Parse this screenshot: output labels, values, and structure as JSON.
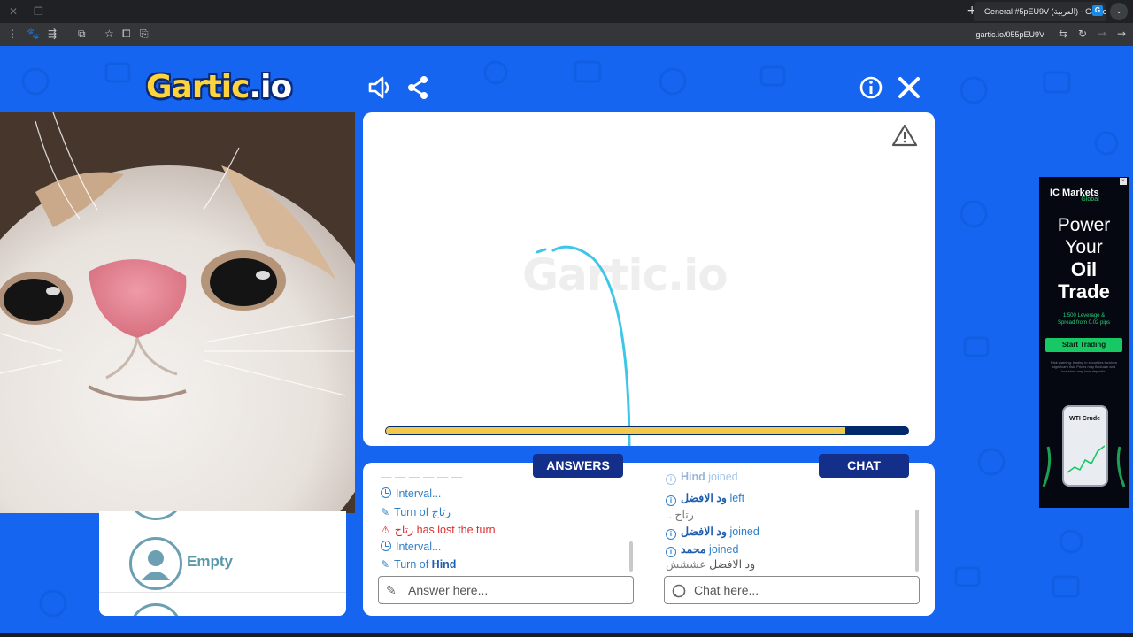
{
  "browser": {
    "tab_title": "General #5pEU9V (العربية) - Gartic",
    "favicon_letter": "G",
    "url": "gartic.io/055pEU9V"
  },
  "game": {
    "logo_main": "Gartic",
    "logo_suffix": ".io",
    "watermark": "Gartic.io",
    "timer_progress": 0.88,
    "drawing_color": "#3ec6e8",
    "progress_fill_color": "#f2c94c"
  },
  "players": {
    "visible_slot_label": "Empty"
  },
  "answers": {
    "tab_label": "ANSWERS",
    "input_placeholder": "Answer here...",
    "lines": [
      {
        "icon": "clock",
        "text": "Interval..."
      },
      {
        "icon": "pencil",
        "prefix": "Turn of ",
        "name": "رتاج"
      },
      {
        "icon": "warning",
        "name": "رتاج",
        "suffix": " has lost the turn"
      },
      {
        "icon": "clock",
        "text": "Interval..."
      },
      {
        "icon": "pencil",
        "prefix": "Turn of ",
        "name": "Hind"
      }
    ]
  },
  "chat": {
    "tab_label": "CHAT",
    "input_placeholder": "Chat here...",
    "lines": [
      {
        "icon": "info",
        "name": "Hind",
        "suffix": " joined",
        "cut": true
      },
      {
        "icon": "info",
        "name": "ود الافضل",
        "suffix": " left"
      },
      {
        "icon": "none",
        "text": ".. رتاج"
      },
      {
        "icon": "info",
        "name": "ود الافضل",
        "suffix": " joined"
      },
      {
        "icon": "info",
        "name": "محمد",
        "suffix": " joined"
      },
      {
        "icon": "none",
        "name": "ود الافضل",
        "suffix": " عششش"
      }
    ]
  },
  "ad": {
    "brand": "IC Markets",
    "brand_sub": "Global",
    "line1": "Power",
    "line2": "Your",
    "line3": "Oil",
    "line4": "Trade",
    "sub1": "1:500 Leverage &",
    "sub2": "Spread from 0.02 pips",
    "cta": "Start Trading",
    "fine": "Risk warning: trading in securities involves significant risk. Prices may fluctuate and investors may lose deposits.",
    "phone_label": "WTI Crude",
    "accent_color": "#17c964"
  }
}
